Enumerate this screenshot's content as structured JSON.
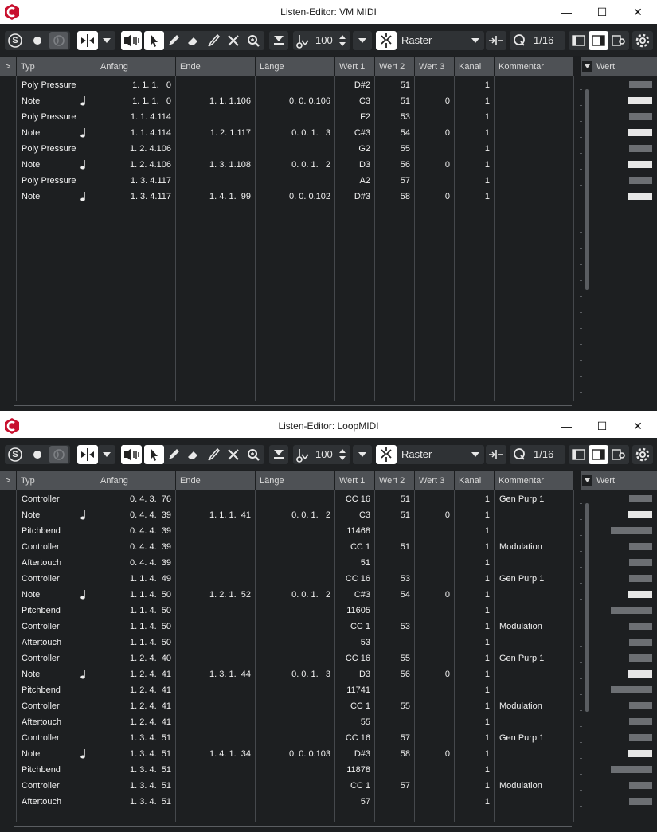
{
  "windows": [
    {
      "title": "Listen-Editor: VM MIDI",
      "window_controls": {
        "minimize": "—",
        "maximize": "☐",
        "close": "✕"
      },
      "toolbar": {
        "solo_icon": "S",
        "velocity_value": "100",
        "snap_type": "Raster",
        "quantize_value": "1/16"
      },
      "columns": [
        "Typ",
        "Anfang",
        "Ende",
        "Länge",
        "Wert 1",
        "Wert 2",
        "Wert 3",
        "Kanal",
        "Kommentar"
      ],
      "expand_label": ">",
      "value_panel_header": "Wert",
      "events": [
        {
          "type": "Poly Pressure",
          "note": false,
          "start": "1. 1. 1.   0",
          "end": "",
          "length": "",
          "v1": "D#2",
          "v2": "51",
          "v3": "",
          "ch": "1",
          "comment": ""
        },
        {
          "type": "Note",
          "note": true,
          "start": "1. 1. 1.   0",
          "end": "1. 1. 1.106",
          "length": "0. 0. 0.106",
          "v1": "C3",
          "v2": "51",
          "v3": "0",
          "ch": "1",
          "comment": ""
        },
        {
          "type": "Poly Pressure",
          "note": false,
          "start": "1. 1. 4.114",
          "end": "",
          "length": "",
          "v1": "F2",
          "v2": "53",
          "v3": "",
          "ch": "1",
          "comment": ""
        },
        {
          "type": "Note",
          "note": true,
          "start": "1. 1. 4.114",
          "end": "1. 2. 1.117",
          "length": "0. 0. 1.   3",
          "v1": "C#3",
          "v2": "54",
          "v3": "0",
          "ch": "1",
          "comment": ""
        },
        {
          "type": "Poly Pressure",
          "note": false,
          "start": "1. 2. 4.106",
          "end": "",
          "length": "",
          "v1": "G2",
          "v2": "55",
          "v3": "",
          "ch": "1",
          "comment": ""
        },
        {
          "type": "Note",
          "note": true,
          "start": "1. 2. 4.106",
          "end": "1. 3. 1.108",
          "length": "0. 0. 1.   2",
          "v1": "D3",
          "v2": "56",
          "v3": "0",
          "ch": "1",
          "comment": ""
        },
        {
          "type": "Poly Pressure",
          "note": false,
          "start": "1. 3. 4.117",
          "end": "",
          "length": "",
          "v1": "A2",
          "v2": "57",
          "v3": "",
          "ch": "1",
          "comment": ""
        },
        {
          "type": "Note",
          "note": true,
          "start": "1. 3. 4.117",
          "end": "1. 4. 1.  99",
          "length": "0. 0. 0.102",
          "v1": "D#3",
          "v2": "58",
          "v3": "0",
          "ch": "1",
          "comment": ""
        }
      ]
    },
    {
      "title": "Listen-Editor: LoopMIDI",
      "window_controls": {
        "minimize": "—",
        "maximize": "☐",
        "close": "✕"
      },
      "toolbar": {
        "solo_icon": "S",
        "velocity_value": "100",
        "snap_type": "Raster",
        "quantize_value": "1/16"
      },
      "columns": [
        "Typ",
        "Anfang",
        "Ende",
        "Länge",
        "Wert 1",
        "Wert 2",
        "Wert 3",
        "Kanal",
        "Kommentar"
      ],
      "expand_label": ">",
      "value_panel_header": "Wert",
      "events": [
        {
          "type": "Controller",
          "note": false,
          "start": "0. 4. 3.  76",
          "end": "",
          "length": "",
          "v1": "CC 16",
          "v2": "51",
          "v3": "",
          "ch": "1",
          "comment": "Gen Purp 1"
        },
        {
          "type": "Note",
          "note": true,
          "start": "0. 4. 4.  39",
          "end": "1. 1. 1.  41",
          "length": "0. 0. 1.   2",
          "v1": "C3",
          "v2": "51",
          "v3": "0",
          "ch": "1",
          "comment": ""
        },
        {
          "type": "Pitchbend",
          "note": false,
          "start": "0. 4. 4.  39",
          "end": "",
          "length": "",
          "v1": "11468",
          "v2": "",
          "v3": "",
          "ch": "1",
          "comment": ""
        },
        {
          "type": "Controller",
          "note": false,
          "start": "0. 4. 4.  39",
          "end": "",
          "length": "",
          "v1": "CC 1",
          "v2": "51",
          "v3": "",
          "ch": "1",
          "comment": "Modulation"
        },
        {
          "type": "Aftertouch",
          "note": false,
          "start": "0. 4. 4.  39",
          "end": "",
          "length": "",
          "v1": "51",
          "v2": "",
          "v3": "",
          "ch": "1",
          "comment": ""
        },
        {
          "type": "Controller",
          "note": false,
          "start": "1. 1. 4.  49",
          "end": "",
          "length": "",
          "v1": "CC 16",
          "v2": "53",
          "v3": "",
          "ch": "1",
          "comment": "Gen Purp 1"
        },
        {
          "type": "Note",
          "note": true,
          "start": "1. 1. 4.  50",
          "end": "1. 2. 1.  52",
          "length": "0. 0. 1.   2",
          "v1": "C#3",
          "v2": "54",
          "v3": "0",
          "ch": "1",
          "comment": ""
        },
        {
          "type": "Pitchbend",
          "note": false,
          "start": "1. 1. 4.  50",
          "end": "",
          "length": "",
          "v1": "11605",
          "v2": "",
          "v3": "",
          "ch": "1",
          "comment": ""
        },
        {
          "type": "Controller",
          "note": false,
          "start": "1. 1. 4.  50",
          "end": "",
          "length": "",
          "v1": "CC 1",
          "v2": "53",
          "v3": "",
          "ch": "1",
          "comment": "Modulation"
        },
        {
          "type": "Aftertouch",
          "note": false,
          "start": "1. 1. 4.  50",
          "end": "",
          "length": "",
          "v1": "53",
          "v2": "",
          "v3": "",
          "ch": "1",
          "comment": ""
        },
        {
          "type": "Controller",
          "note": false,
          "start": "1. 2. 4.  40",
          "end": "",
          "length": "",
          "v1": "CC 16",
          "v2": "55",
          "v3": "",
          "ch": "1",
          "comment": "Gen Purp 1"
        },
        {
          "type": "Note",
          "note": true,
          "start": "1. 2. 4.  41",
          "end": "1. 3. 1.  44",
          "length": "0. 0. 1.   3",
          "v1": "D3",
          "v2": "56",
          "v3": "0",
          "ch": "1",
          "comment": ""
        },
        {
          "type": "Pitchbend",
          "note": false,
          "start": "1. 2. 4.  41",
          "end": "",
          "length": "",
          "v1": "11741",
          "v2": "",
          "v3": "",
          "ch": "1",
          "comment": ""
        },
        {
          "type": "Controller",
          "note": false,
          "start": "1. 2. 4.  41",
          "end": "",
          "length": "",
          "v1": "CC 1",
          "v2": "55",
          "v3": "",
          "ch": "1",
          "comment": "Modulation"
        },
        {
          "type": "Aftertouch",
          "note": false,
          "start": "1. 2. 4.  41",
          "end": "",
          "length": "",
          "v1": "55",
          "v2": "",
          "v3": "",
          "ch": "1",
          "comment": ""
        },
        {
          "type": "Controller",
          "note": false,
          "start": "1. 3. 4.  51",
          "end": "",
          "length": "",
          "v1": "CC 16",
          "v2": "57",
          "v3": "",
          "ch": "1",
          "comment": "Gen Purp 1"
        },
        {
          "type": "Note",
          "note": true,
          "start": "1. 3. 4.  51",
          "end": "1. 4. 1.  34",
          "length": "0. 0. 0.103",
          "v1": "D#3",
          "v2": "58",
          "v3": "0",
          "ch": "1",
          "comment": ""
        },
        {
          "type": "Pitchbend",
          "note": false,
          "start": "1. 3. 4.  51",
          "end": "",
          "length": "",
          "v1": "11878",
          "v2": "",
          "v3": "",
          "ch": "1",
          "comment": ""
        },
        {
          "type": "Controller",
          "note": false,
          "start": "1. 3. 4.  51",
          "end": "",
          "length": "",
          "v1": "CC 1",
          "v2": "57",
          "v3": "",
          "ch": "1",
          "comment": "Modulation"
        },
        {
          "type": "Aftertouch",
          "note": false,
          "start": "1. 3. 4.  51",
          "end": "",
          "length": "",
          "v1": "57",
          "v2": "",
          "v3": "",
          "ch": "1",
          "comment": ""
        }
      ]
    }
  ],
  "colors": {
    "background": "#1d1f21",
    "header": "#4e5155",
    "bar_selected": "#e6e6e6",
    "bar_normal": "#6c6f73",
    "accent_logo": "#c8102e"
  }
}
